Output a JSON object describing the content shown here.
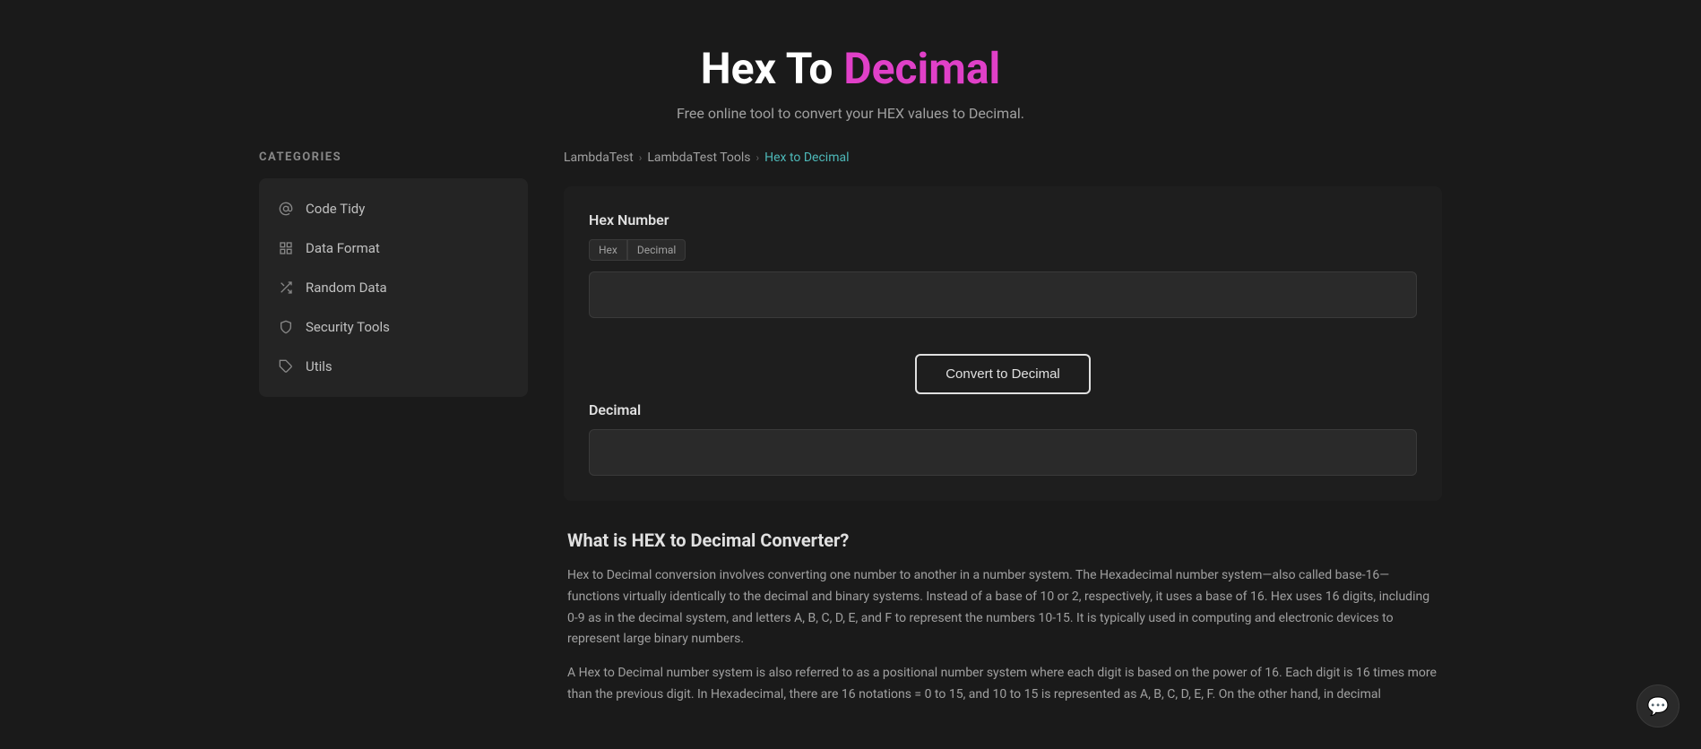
{
  "header": {
    "title_part1": "Hex To ",
    "title_part2": "Decimal",
    "subtitle": "Free online tool to convert your HEX values to Decimal."
  },
  "sidebar": {
    "categories_label": "CATEGORIES",
    "items": [
      {
        "id": "code-tidy",
        "label": "Code Tidy",
        "icon": "at"
      },
      {
        "id": "data-format",
        "label": "Data Format",
        "icon": "grid"
      },
      {
        "id": "random-data",
        "label": "Random Data",
        "icon": "shuffle"
      },
      {
        "id": "security-tools",
        "label": "Security Tools",
        "icon": "shield"
      },
      {
        "id": "utils",
        "label": "Utils",
        "icon": "tag"
      }
    ]
  },
  "breadcrumb": {
    "items": [
      {
        "id": "lambdatest",
        "label": "LambdaTest",
        "link": true
      },
      {
        "id": "lambdatest-tools",
        "label": "LambdaTest Tools",
        "link": true
      },
      {
        "id": "hex-to-decimal",
        "label": "Hex to Decimal",
        "current": true
      }
    ]
  },
  "tool": {
    "input_label": "Hex Number",
    "input_value": "",
    "input_placeholder": "",
    "hex_decimal_badge_left": "Hex",
    "hex_decimal_badge_right": "Decimal",
    "convert_button_label": "Convert to Decimal",
    "output_label": "Decimal",
    "output_value": ""
  },
  "info": {
    "title": "What is HEX to Decimal Converter?",
    "paragraphs": [
      "Hex to Decimal conversion involves converting one number to another in a number system. The Hexadecimal number system—also called base-16—functions virtually identically to the decimal and binary systems. Instead of a base of 10 or 2, respectively, it uses a base of 16. Hex uses 16 digits, including 0-9 as in the decimal system, and letters A, B, C, D, E, and F to represent the numbers 10-15. It is typically used in computing and electronic devices to represent large binary numbers.",
      "A Hex to Decimal number system is also referred to as a positional number system where each digit is based on the power of 16. Each digit is 16 times more than the previous digit. In Hexadecimal, there are 16 notations = 0 to 15, and 10 to 15 is represented as A, B, C, D, E, F. On the other hand, in decimal"
    ]
  },
  "chat": {
    "icon": "💬"
  }
}
